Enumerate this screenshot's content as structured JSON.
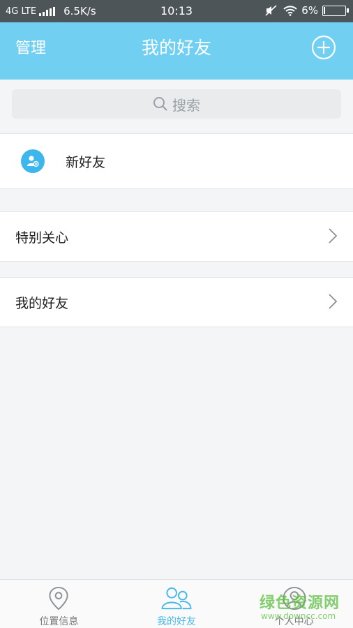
{
  "status_bar": {
    "network": "4G LTE",
    "speed": "6.5K/s",
    "time": "10:13",
    "battery": "6%",
    "battery_level": 0.06
  },
  "header": {
    "left_label": "管理",
    "title": "我的好友",
    "add_icon": "plus-circle-icon"
  },
  "search": {
    "placeholder": "搜索",
    "icon": "search-icon"
  },
  "list": {
    "new_friend": "新好友",
    "special_care": "特别关心",
    "my_friends": "我的好友"
  },
  "tabs": [
    {
      "label": "位置信息",
      "icon": "location-pin-icon",
      "active": false
    },
    {
      "label": "我的好友",
      "icon": "friends-icon",
      "active": true
    },
    {
      "label": "个人中心",
      "icon": "profile-icon",
      "active": false
    }
  ],
  "watermark": {
    "text": "绿色资源网",
    "url": "www.downcc.com"
  },
  "colors": {
    "header": "#71d0f2",
    "accent": "#46b8ea",
    "statusbar": "#4d5559"
  }
}
